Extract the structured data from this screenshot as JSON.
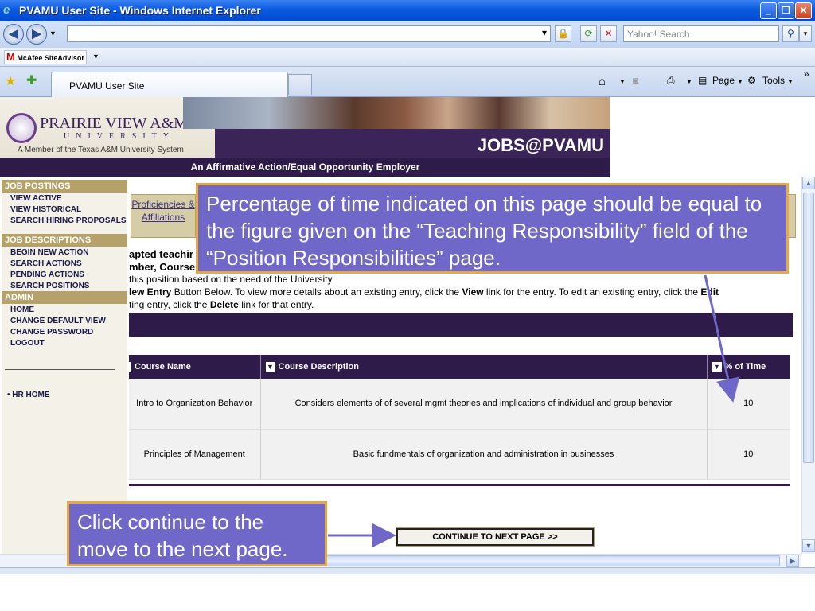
{
  "window": {
    "title": "PVAMU User Site - Windows Internet Explorer",
    "minimize": "_",
    "restore": "❐",
    "close": "✕"
  },
  "browser": {
    "url_placeholder": "",
    "search_placeholder": "Yahoo! Search",
    "toolbar_addon": "McAfee SiteAdvisor",
    "tab_label": "PVAMU User Site",
    "page_menu": "Page",
    "tools_menu": "Tools"
  },
  "banner": {
    "university": "PRAIRIE VIEW A&M",
    "university_sub": "UNIVERSITY",
    "member_line": "A Member of the Texas A&M University System",
    "jobs_title": "JOBS@PVAMU",
    "eeo": "An Affirmative Action/Equal Opportunity Employer"
  },
  "sidebar": {
    "sections": [
      {
        "heading": "JOB POSTINGS",
        "items": [
          "VIEW ACTIVE",
          "VIEW HISTORICAL",
          "SEARCH HIRING PROPOSALS"
        ]
      },
      {
        "heading": "JOB DESCRIPTIONS",
        "items": [
          "BEGIN NEW ACTION",
          "SEARCH ACTIONS",
          "PENDING ACTIONS",
          "SEARCH POSITIONS"
        ]
      },
      {
        "heading": "ADMIN",
        "items": [
          "HOME",
          "CHANGE DEFAULT VIEW",
          "CHANGE PASSWORD",
          "LOGOUT"
        ]
      }
    ],
    "hr_home": "• HR HOME"
  },
  "main": {
    "tab_proficiencies": "Proficiencies & Affiliations",
    "desc_line1": "apted teachir",
    "desc_line2": "mber, Course",
    "desc_line3": " this position based on the need of the University",
    "desc_line4_a": "lew Entry",
    "desc_line4_b": " Button Below. To view more details about an existing entry, click the ",
    "desc_line4_c": "View",
    "desc_line4_d": " link for the entry. To edit an existing entry, click the ",
    "desc_line4_e": "Edit",
    "desc_line5_a": "ting entry, click the ",
    "desc_line5_b": "Delete",
    "desc_line5_c": " link for that entry.",
    "columns": [
      "Course Name",
      "Course Description",
      "% of Time"
    ],
    "rows": [
      {
        "name": "Intro to Organization Behavior",
        "description": "Considers elements of of several mgmt theories and implications of individual and group behavior",
        "time": "10"
      },
      {
        "name": "Principles of Management",
        "description": "Basic fundmentals of organization and administration in businesses",
        "time": "10"
      }
    ],
    "continue_button": "CONTINUE TO NEXT PAGE >>"
  },
  "callouts": {
    "time_note": "Percentage of time indicated on this page should be equal to the figure given on the “Teaching Responsibility” field of the “Position Responsibilities” page.",
    "continue_note": "Click continue to the move to the next page."
  },
  "colors": {
    "titlebar": "#0a5ae0",
    "brand_purple": "#2e1b4a",
    "brand_gold": "#b5a26a",
    "callout_fill": "#6f68c9",
    "callout_border": "#e9a93b"
  }
}
